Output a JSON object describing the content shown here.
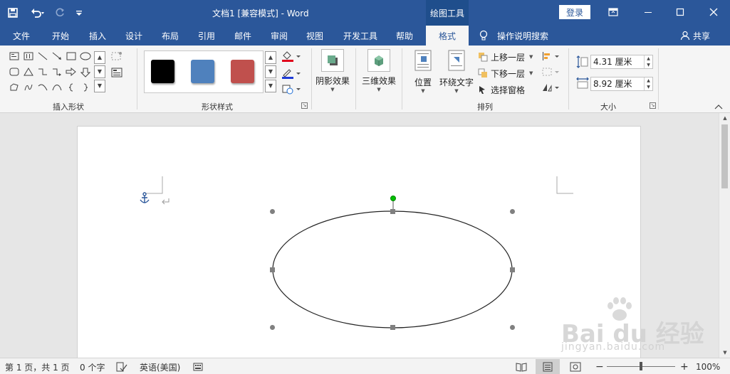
{
  "window": {
    "title": "文档1 [兼容模式]  -  Word",
    "context_tab_header": "绘图工具",
    "login_label": "登录"
  },
  "qat": {
    "save_icon": "save-icon",
    "undo_icon": "undo-icon",
    "redo_icon": "redo-icon",
    "customize_icon": "customize-qat-icon"
  },
  "tabs": [
    {
      "label": "文件"
    },
    {
      "label": "开始"
    },
    {
      "label": "插入"
    },
    {
      "label": "设计"
    },
    {
      "label": "布局"
    },
    {
      "label": "引用"
    },
    {
      "label": "邮件"
    },
    {
      "label": "审阅"
    },
    {
      "label": "视图"
    },
    {
      "label": "开发工具"
    },
    {
      "label": "帮助"
    },
    {
      "label": "格式",
      "active": true
    }
  ],
  "tellme": {
    "label": "操作说明搜索"
  },
  "share": {
    "label": "共享"
  },
  "ribbon": {
    "groups": {
      "insert_shapes": "插入形状",
      "shape_styles": "形状样式",
      "arrange": "排列",
      "size": "大小"
    },
    "style_swatches": [
      "#000000",
      "#4f81bd",
      "#c0504d"
    ],
    "shadow_effects": "阴影效果",
    "three_d_effects": "三维效果",
    "position": "位置",
    "wrap_text": "环绕文字",
    "bring_forward": "上移一层",
    "send_backward": "下移一层",
    "selection_pane": "选择窗格",
    "height_value": "4.31 厘米",
    "width_value": "8.92 厘米"
  },
  "colors": {
    "brand": "#2b579a",
    "selection_handle": "#808080",
    "rotation_handle": "#00c000",
    "fill_red": "#e0001b",
    "line_blue": "#1f3bd6"
  },
  "status": {
    "page_info": "第 1 页，共 1 页",
    "word_count": "0 个字",
    "language": "英语(美国)",
    "zoom": "100%"
  },
  "watermark": {
    "brand": "Bai du 经验",
    "url": "jingyan.baidu.com"
  }
}
